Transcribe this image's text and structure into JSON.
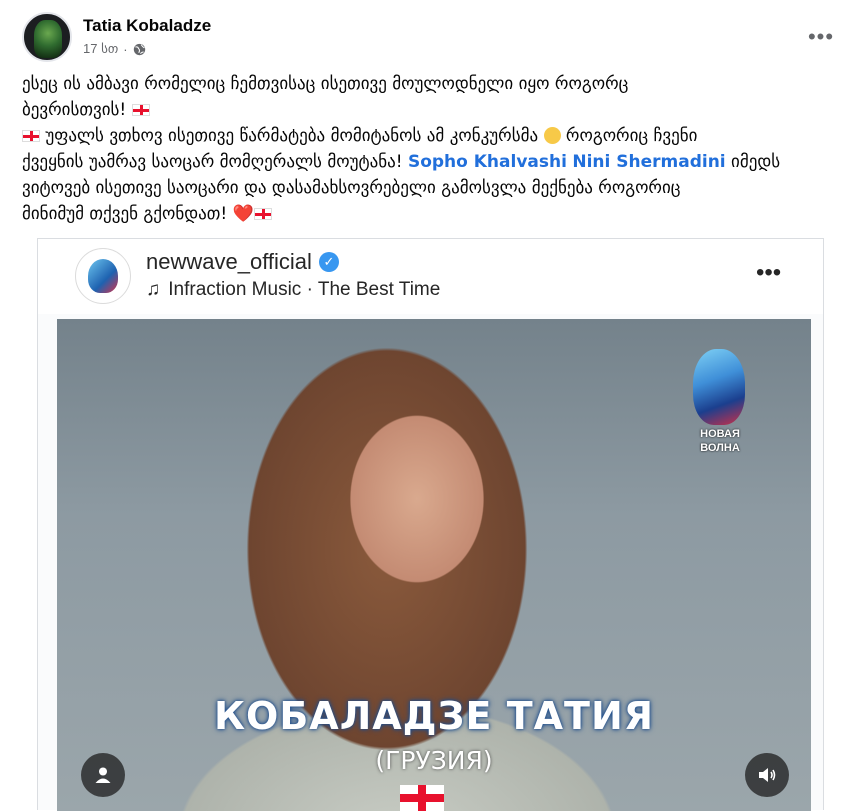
{
  "post": {
    "author": "Tatia Kobaladze",
    "time": "17 სთ",
    "separator": "·",
    "privacy_icon": "globe-icon",
    "more_icon": "more-horizontal-icon",
    "more_label": "•••",
    "text": {
      "line1": "ესეც ის ამბავი რომელიც ჩემთვისაც ისეთივე მოულოდნელი იყო როგორც",
      "line2": "ბევრისთვის!",
      "line3a": "უფალს ვთხოვ ისეთივე წარმატება მომიტანოს ამ კონკურსმა",
      "line3b": "როგორიც ჩვენი",
      "line4a": "ქვეყნის უამრავ საოცარ მომღერალს მოუტანა!",
      "mention1": "Sopho Khalvashi",
      "mention2": "Nini Shermadini",
      "line4b": "იმედს",
      "line5": "ვიტოვებ ისეთივე საოცარი და დასამახსოვრებელი გამოსვლა მექნება როგორიც",
      "line6": "მინიმუმ თქვენ გქონდათ!",
      "heart": "❤️"
    }
  },
  "shared": {
    "account": "newwave_official",
    "verified_mark": "✓",
    "music_icon": "music-note-icon",
    "music_glyph": "♫",
    "music": "Infraction Music · The Best Time",
    "more_label": "•••",
    "photo": {
      "logo_text_line1": "НОВАЯ",
      "logo_text_line2": "ВОЛНА",
      "title": "КОБАЛАДЗЕ ТАТИЯ",
      "subtitle": "(ГРУЗИЯ)",
      "user_icon": "user-icon",
      "sound_icon": "speaker-icon"
    }
  },
  "colors": {
    "mention": "#216fdb",
    "secondary_text": "#65676b",
    "verified": "#3897f0"
  }
}
